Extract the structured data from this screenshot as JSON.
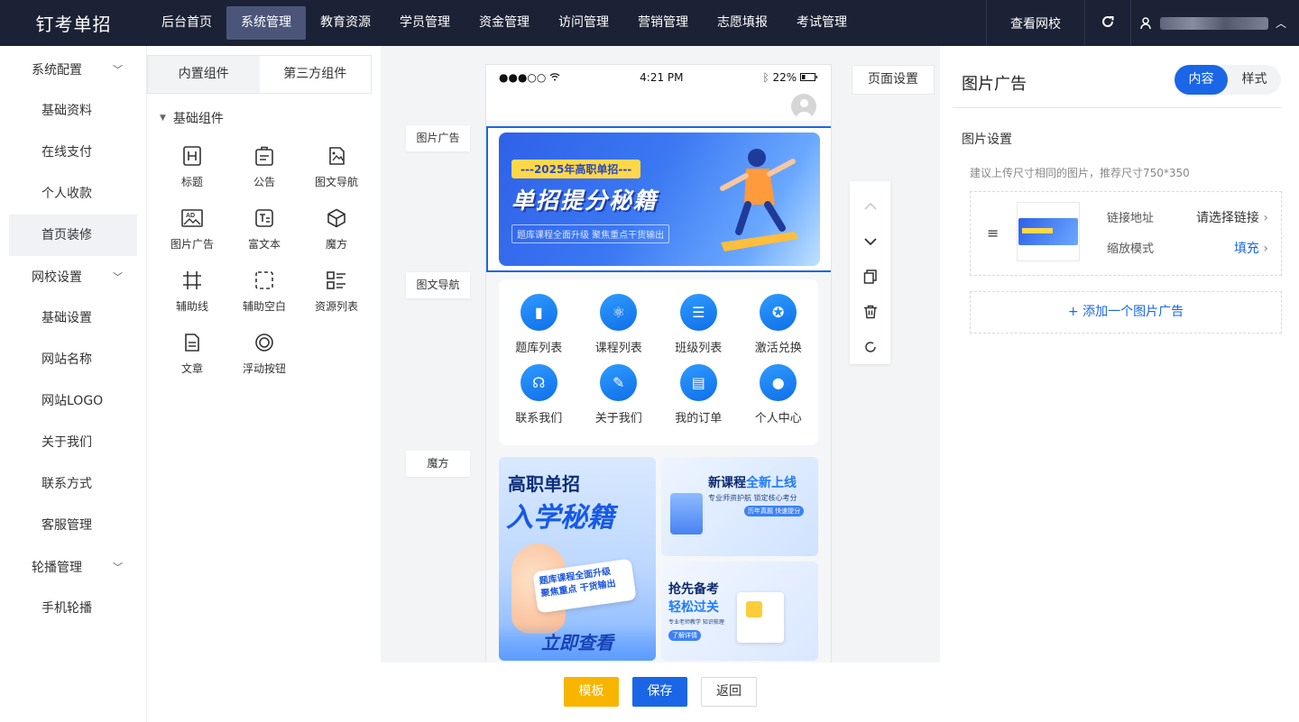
{
  "brand": "钉考单招",
  "topnav": [
    "后台首页",
    "系统管理",
    "教育资源",
    "学员管理",
    "资金管理",
    "访问管理",
    "营销管理",
    "志愿填报",
    "考试管理"
  ],
  "topright": {
    "view_site": "查看网校"
  },
  "sidebar": {
    "groups": [
      {
        "label": "系统配置",
        "items": [
          "基础资料",
          "在线支付",
          "个人收款",
          "首页装修"
        ]
      },
      {
        "label": "网校设置",
        "items": [
          "基础设置",
          "网站名称",
          "网站LOGO",
          "关于我们",
          "联系方式",
          "客服管理"
        ]
      },
      {
        "label": "轮播管理",
        "items": [
          "手机轮播"
        ]
      }
    ]
  },
  "components": {
    "tabs": [
      "内置组件",
      "第三方组件"
    ],
    "category": "基础组件",
    "widgets": [
      "标题",
      "公告",
      "图文导航",
      "图片广告",
      "富文本",
      "魔方",
      "辅助线",
      "辅助空白",
      "资源列表",
      "文章",
      "浮动按钮"
    ]
  },
  "phone": {
    "carrier": "●●●○○",
    "time": "4:21 PM",
    "battery": "22%",
    "banner": {
      "pill": "---2025年高职单招---",
      "headline": "单招提分秘籍",
      "sub": "题库课程全面升级 聚焦重点干货输出"
    },
    "nav": [
      "题库列表",
      "课程列表",
      "班级列表",
      "激活兑换",
      "联系我们",
      "关于我们",
      "我的订单",
      "个人中心"
    ],
    "magic": {
      "left_h1": "高职单招",
      "left_h2": "入学秘籍",
      "left_card1": "题库课程全面升级",
      "left_card2": "聚焦重点 干货输出",
      "left_cta": "立即查看",
      "rt_title_a": "新课程",
      "rt_title_b": "全新上线",
      "rt_sub": "专业师资护航 锁定核心考分",
      "rt_tag": "历年真题 快速提分",
      "rb_t1": "抢先备考",
      "rb_t2": "轻松过关",
      "rb_t3": "专业老师教学 知识梳理",
      "rb_t4": "了解详情"
    }
  },
  "tags": [
    "图片广告",
    "图文导航",
    "魔方"
  ],
  "page_settings": "页面设置",
  "right": {
    "title": "图片广告",
    "seg": [
      "内容",
      "样式"
    ],
    "section": "图片设置",
    "hint": "建议上传尺寸相同的图片，推荐尺寸750*350",
    "link_label": "链接地址",
    "link_value": "请选择链接",
    "zoom_label": "缩放模式",
    "zoom_value": "填充",
    "add_label": "+ 添加一个图片广告"
  },
  "footer": [
    "模板",
    "保存",
    "返回"
  ],
  "colors": {
    "topbar": "#1c2235",
    "primary": "#1a66e6",
    "warning": "#f7b500"
  }
}
